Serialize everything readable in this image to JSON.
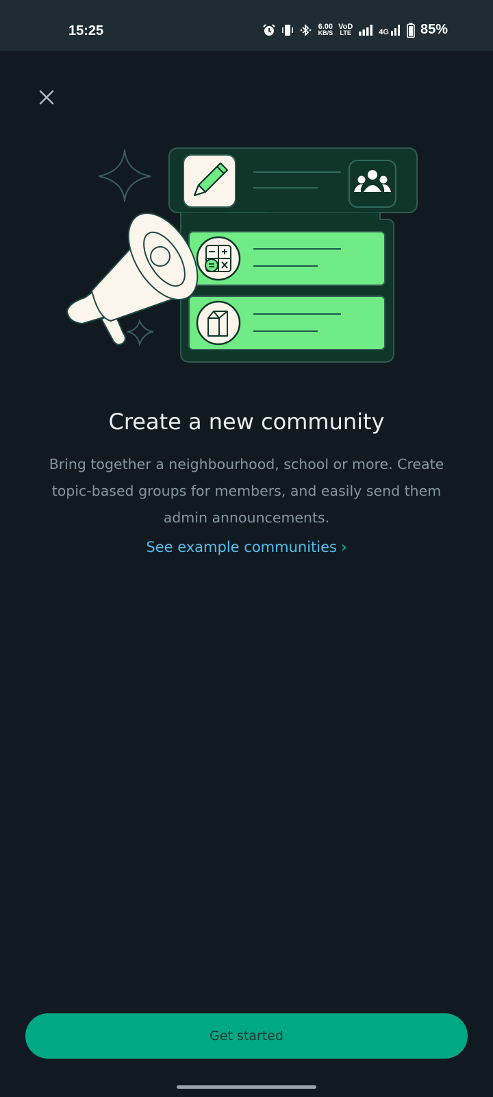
{
  "status_bar": {
    "time": "15:25",
    "net_speed_value": "6.00",
    "net_speed_unit": "KB/S",
    "volte_top": "VoD",
    "volte_bottom": "LTE",
    "network": "4G",
    "battery": "85%",
    "icons": [
      "alarm-icon",
      "vibrate-icon",
      "bluetooth-icon",
      "signal-icon",
      "battery-icon"
    ]
  },
  "header": {
    "close_icon": "close-icon"
  },
  "main": {
    "title": "Create a new community",
    "description": "Bring together a neighbourhood, school or more. Create topic-based groups for members, and easily send them admin announcements.",
    "example_link": "See example communities",
    "example_link_icon": "chevron-right-icon"
  },
  "footer": {
    "primary_button": "Get started"
  },
  "colors": {
    "background": "#111a21",
    "status_bar": "#1f2c33",
    "accent": "#00a884",
    "link": "#53bdeb",
    "illustration_green": "#71eb85",
    "illustration_dark": "#103529"
  }
}
